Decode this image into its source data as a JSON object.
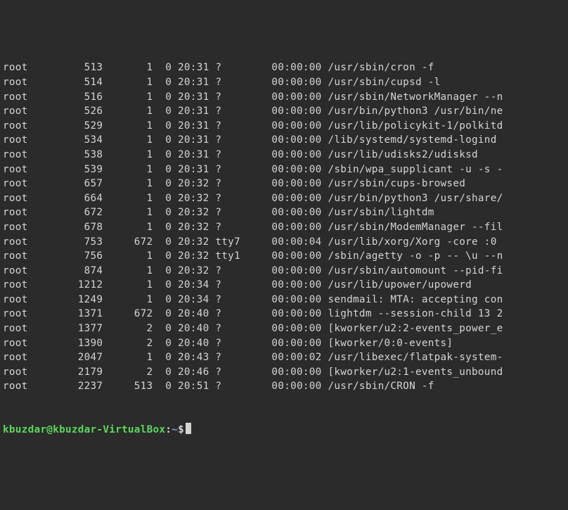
{
  "rows": [
    {
      "user": "root",
      "pid": "513",
      "ppid": "1",
      "c": "0",
      "stime": "20:31",
      "tty": "?",
      "time": "00:00:00",
      "cmd": "/usr/sbin/cron -f"
    },
    {
      "user": "root",
      "pid": "514",
      "ppid": "1",
      "c": "0",
      "stime": "20:31",
      "tty": "?",
      "time": "00:00:00",
      "cmd": "/usr/sbin/cupsd -l"
    },
    {
      "user": "root",
      "pid": "516",
      "ppid": "1",
      "c": "0",
      "stime": "20:31",
      "tty": "?",
      "time": "00:00:00",
      "cmd": "/usr/sbin/NetworkManager --n"
    },
    {
      "user": "root",
      "pid": "526",
      "ppid": "1",
      "c": "0",
      "stime": "20:31",
      "tty": "?",
      "time": "00:00:00",
      "cmd": "/usr/bin/python3 /usr/bin/ne"
    },
    {
      "user": "root",
      "pid": "529",
      "ppid": "1",
      "c": "0",
      "stime": "20:31",
      "tty": "?",
      "time": "00:00:00",
      "cmd": "/usr/lib/policykit-1/polkitd"
    },
    {
      "user": "root",
      "pid": "534",
      "ppid": "1",
      "c": "0",
      "stime": "20:31",
      "tty": "?",
      "time": "00:00:00",
      "cmd": "/lib/systemd/systemd-logind"
    },
    {
      "user": "root",
      "pid": "538",
      "ppid": "1",
      "c": "0",
      "stime": "20:31",
      "tty": "?",
      "time": "00:00:00",
      "cmd": "/usr/lib/udisks2/udisksd"
    },
    {
      "user": "root",
      "pid": "539",
      "ppid": "1",
      "c": "0",
      "stime": "20:31",
      "tty": "?",
      "time": "00:00:00",
      "cmd": "/sbin/wpa_supplicant -u -s -"
    },
    {
      "user": "root",
      "pid": "657",
      "ppid": "1",
      "c": "0",
      "stime": "20:32",
      "tty": "?",
      "time": "00:00:00",
      "cmd": "/usr/sbin/cups-browsed"
    },
    {
      "user": "root",
      "pid": "664",
      "ppid": "1",
      "c": "0",
      "stime": "20:32",
      "tty": "?",
      "time": "00:00:00",
      "cmd": "/usr/bin/python3 /usr/share/"
    },
    {
      "user": "root",
      "pid": "672",
      "ppid": "1",
      "c": "0",
      "stime": "20:32",
      "tty": "?",
      "time": "00:00:00",
      "cmd": "/usr/sbin/lightdm"
    },
    {
      "user": "root",
      "pid": "678",
      "ppid": "1",
      "c": "0",
      "stime": "20:32",
      "tty": "?",
      "time": "00:00:00",
      "cmd": "/usr/sbin/ModemManager --fil"
    },
    {
      "user": "root",
      "pid": "753",
      "ppid": "672",
      "c": "0",
      "stime": "20:32",
      "tty": "tty7",
      "time": "00:00:04",
      "cmd": "/usr/lib/xorg/Xorg -core :0"
    },
    {
      "user": "root",
      "pid": "756",
      "ppid": "1",
      "c": "0",
      "stime": "20:32",
      "tty": "tty1",
      "time": "00:00:00",
      "cmd": "/sbin/agetty -o -p -- \\u --n"
    },
    {
      "user": "root",
      "pid": "874",
      "ppid": "1",
      "c": "0",
      "stime": "20:32",
      "tty": "?",
      "time": "00:00:00",
      "cmd": "/usr/sbin/automount --pid-fi"
    },
    {
      "user": "root",
      "pid": "1212",
      "ppid": "1",
      "c": "0",
      "stime": "20:34",
      "tty": "?",
      "time": "00:00:00",
      "cmd": "/usr/lib/upower/upowerd"
    },
    {
      "user": "root",
      "pid": "1249",
      "ppid": "1",
      "c": "0",
      "stime": "20:34",
      "tty": "?",
      "time": "00:00:00",
      "cmd": "sendmail: MTA: accepting con"
    },
    {
      "user": "root",
      "pid": "1371",
      "ppid": "672",
      "c": "0",
      "stime": "20:40",
      "tty": "?",
      "time": "00:00:00",
      "cmd": "lightdm --session-child 13 2"
    },
    {
      "user": "root",
      "pid": "1377",
      "ppid": "2",
      "c": "0",
      "stime": "20:40",
      "tty": "?",
      "time": "00:00:00",
      "cmd": "[kworker/u2:2-events_power_e"
    },
    {
      "user": "root",
      "pid": "1390",
      "ppid": "2",
      "c": "0",
      "stime": "20:40",
      "tty": "?",
      "time": "00:00:00",
      "cmd": "[kworker/0:0-events]"
    },
    {
      "user": "root",
      "pid": "2047",
      "ppid": "1",
      "c": "0",
      "stime": "20:43",
      "tty": "?",
      "time": "00:00:02",
      "cmd": "/usr/libexec/flatpak-system-"
    },
    {
      "user": "root",
      "pid": "2179",
      "ppid": "2",
      "c": "0",
      "stime": "20:46",
      "tty": "?",
      "time": "00:00:00",
      "cmd": "[kworker/u2:1-events_unbound"
    },
    {
      "user": "root",
      "pid": "2237",
      "ppid": "513",
      "c": "0",
      "stime": "20:51",
      "tty": "?",
      "time": "00:00:00",
      "cmd": "/usr/sbin/CRON -f"
    }
  ],
  "prompt": {
    "user": "kbuzdar",
    "host": "kbuzdar-VirtualBox",
    "path": "~",
    "end": "$"
  }
}
